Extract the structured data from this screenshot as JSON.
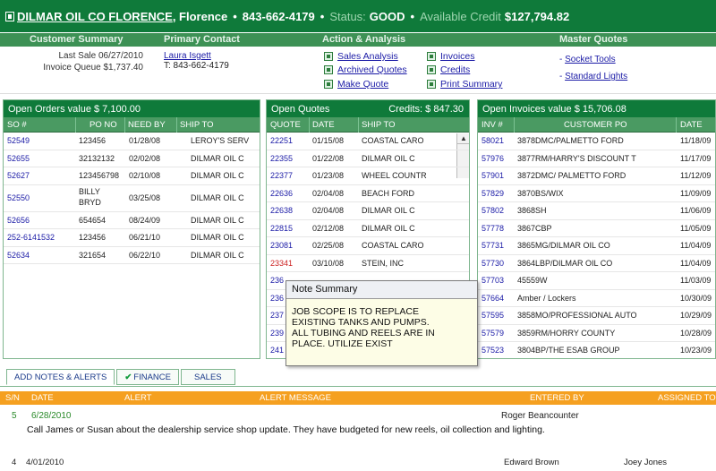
{
  "header": {
    "customer_name": "DILMAR OIL CO FLORENCE",
    "city": "Florence",
    "phone": "843-662-4179",
    "status_label": "Status:",
    "status_value": "GOOD",
    "credit_label": "Available Credit",
    "credit_value": "$127,794.82"
  },
  "sections": {
    "customer_summary": "Customer Summary",
    "primary_contact": "Primary Contact",
    "action_analysis": "Action & Analysis",
    "master_quotes": "Master Quotes"
  },
  "customer_summary": {
    "last_sale": "Last Sale 06/27/2010",
    "invoice_queue": "Invoice Queue $1,737.40"
  },
  "contact": {
    "name": "Laura Isgett",
    "phone": "T: 843-662-4179"
  },
  "actions": {
    "sales_analysis": "Sales Analysis",
    "archived_quotes": "Archived Quotes",
    "make_quote": "Make Quote",
    "invoices": "Invoices",
    "credits": "Credits",
    "print_summary": "Print Summary"
  },
  "master_quotes": {
    "socket_tools": "Socket Tools",
    "standard_lights": "Standard Lights"
  },
  "open_orders": {
    "title": "Open Orders value $ 7,100.00",
    "columns": [
      "SO #",
      "PO NO",
      "NEED BY",
      "SHIP TO"
    ],
    "rows": [
      {
        "so": "52549",
        "po": "123456",
        "need": "01/28/08",
        "ship": "LEROY'S SERV"
      },
      {
        "so": "52655",
        "po": "32132132",
        "need": "02/02/08",
        "ship": "DILMAR OIL C"
      },
      {
        "so": "52627",
        "po": "123456798",
        "need": "02/10/08",
        "ship": "DILMAR OIL C"
      },
      {
        "so": "52550",
        "po": "BILLY BRYD",
        "po1": "BILLY",
        "po2": "BRYD",
        "need": "03/25/08",
        "ship": "DILMAR OIL C"
      },
      {
        "so": "52656",
        "po": "654654",
        "need": "08/24/09",
        "ship": "DILMAR OIL C"
      },
      {
        "so": "252-6141532",
        "po": "123456",
        "need": "06/21/10",
        "ship": "DILMAR OIL C"
      },
      {
        "so": "52634",
        "po": "321654",
        "need": "06/22/10",
        "ship": "DILMAR OIL C"
      }
    ]
  },
  "open_quotes": {
    "title": "Open Quotes",
    "credits": "Credits: $ 847.30",
    "columns": [
      "QUOTE",
      "DATE",
      "SHIP TO"
    ],
    "rows": [
      {
        "quote": "22251",
        "date": "01/15/08",
        "ship": "COASTAL CARO"
      },
      {
        "quote": "22355",
        "date": "01/22/08",
        "ship": "DILMAR OIL C"
      },
      {
        "quote": "22377",
        "date": "01/23/08",
        "ship": "WHEEL COUNTR"
      },
      {
        "quote": "22636",
        "date": "02/04/08",
        "ship": "BEACH FORD"
      },
      {
        "quote": "22638",
        "date": "02/04/08",
        "ship": "DILMAR OIL C"
      },
      {
        "quote": "22815",
        "date": "02/12/08",
        "ship": "DILMAR OIL C"
      },
      {
        "quote": "23081",
        "date": "02/25/08",
        "ship": "COASTAL CARO"
      },
      {
        "quote": "23341",
        "date": "03/10/08",
        "ship": "STEIN, INC"
      },
      {
        "quote": "236",
        "date": "",
        "ship": ""
      },
      {
        "quote": "236",
        "date": "",
        "ship": ""
      },
      {
        "quote": "237",
        "date": "",
        "ship": ""
      },
      {
        "quote": "239",
        "date": "",
        "ship": ""
      },
      {
        "quote": "241",
        "date": "",
        "ship": ""
      }
    ]
  },
  "open_invoices": {
    "title": "Open Invoices value $ 15,706.08",
    "columns": [
      "INV #",
      "CUSTOMER PO",
      "DATE"
    ],
    "rows": [
      {
        "inv": "58021",
        "po": "3878DMC/PALMETTO FORD",
        "date": "11/18/09"
      },
      {
        "inv": "57976",
        "po": "3877RM/HARRY'S DISCOUNT T",
        "date": "11/17/09"
      },
      {
        "inv": "57901",
        "po": "3872DMC/ PALMETTO FORD",
        "date": "11/12/09"
      },
      {
        "inv": "57829",
        "po": "3870BS/WIX",
        "date": "11/09/09"
      },
      {
        "inv": "57802",
        "po": "3868SH",
        "date": "11/06/09"
      },
      {
        "inv": "57778",
        "po": "3867CBP",
        "date": "11/05/09"
      },
      {
        "inv": "57731",
        "po": "3865MG/DILMAR OIL CO",
        "date": "11/04/09"
      },
      {
        "inv": "57730",
        "po": "3864LBP/DILMAR OIL CO",
        "date": "11/04/09"
      },
      {
        "inv": "57703",
        "po": "45559W",
        "date": "11/03/09"
      },
      {
        "inv": "57664",
        "po": "Amber / Lockers",
        "date": "10/30/09"
      },
      {
        "inv": "57595",
        "po": "3858MO/PROFESSIONAL AUTO",
        "date": "10/29/09"
      },
      {
        "inv": "57579",
        "po": "3859RM/HORRY COUNTY",
        "date": "10/28/09"
      },
      {
        "inv": "57523",
        "po": "3804BP/THE ESAB GROUP",
        "date": "10/23/09"
      }
    ]
  },
  "note": {
    "title": "Note Summary",
    "line1": "JOB SCOPE IS TO REPLACE",
    "line2": "EXISTING TANKS AND PUMPS.",
    "line3": "ALL TUBING AND REELS ARE IN",
    "line4": "PLACE. UTILIZE EXIST"
  },
  "tabs": {
    "add_notes": "ADD NOTES & ALERTS",
    "finance": "FINANCE",
    "sales": "SALES"
  },
  "alerts": {
    "columns": {
      "sn": "S/N",
      "date": "DATE",
      "alert": "ALERT",
      "message": "ALERT MESSAGE",
      "entered": "ENTERED BY",
      "assigned": "ASSIGNED TO"
    },
    "row1": {
      "sn": "5",
      "date": "6/28/2010",
      "entered": "Roger Beancounter",
      "message": "Call James or Susan about the dealership service shop update.  They have budgeted for new reels, oil collection and lighting."
    },
    "row2": {
      "sn": "4",
      "date": "4/01/2010",
      "entered": "Edward Brown",
      "assigned": "Joey Jones"
    }
  }
}
